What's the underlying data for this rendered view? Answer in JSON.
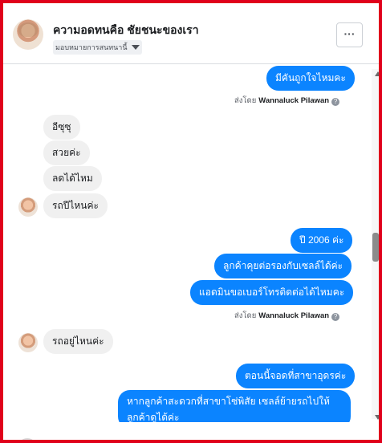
{
  "header": {
    "title": "ความอดทนคือ ชัยชนะของเรา",
    "assign_label": "มอบหมายการสนทนานี้",
    "more_label": "···"
  },
  "messages": [
    {
      "side": "out",
      "text": "มีคันถูกใจไหมคะ"
    },
    {
      "type": "sent_by",
      "prefix": "ส่งโดย",
      "name": "Wannaluck Pilawan",
      "help": "?"
    },
    {
      "side": "in",
      "text": "อีซุซุ"
    },
    {
      "side": "in",
      "text": "สวยค่ะ"
    },
    {
      "side": "in",
      "text": "ลดได้ไหม"
    },
    {
      "side": "in",
      "text": "รถปีไหนค่ะ"
    },
    {
      "side": "out",
      "text": "ปี 2006 ค่ะ"
    },
    {
      "side": "out",
      "text": "ลูกค้าคุยต่อรองกับเซลล์ได้ค่ะ"
    },
    {
      "side": "out",
      "text": "แอดมินขอเบอร์โทรติดต่อได้ไหมคะ"
    },
    {
      "type": "sent_by",
      "prefix": "ส่งโดย",
      "name": "Wannaluck Pilawan",
      "help": "?"
    },
    {
      "side": "in",
      "text": "รถอยู่ไหนค่ะ"
    },
    {
      "side": "out",
      "text": "ตอนนี้จอดที่สาขาอุดรค่ะ"
    },
    {
      "side": "out",
      "text": "หากลูกค้าสะดวกที่สาขาโซ่พิสัย เซลล์ย้ายรถไปให้ลูกค้าดูได้ค่ะ"
    }
  ],
  "colors": {
    "outgoing_bubble": "#0b84ff",
    "incoming_bubble": "#f0f0f0",
    "frame_border": "#e0001b"
  }
}
